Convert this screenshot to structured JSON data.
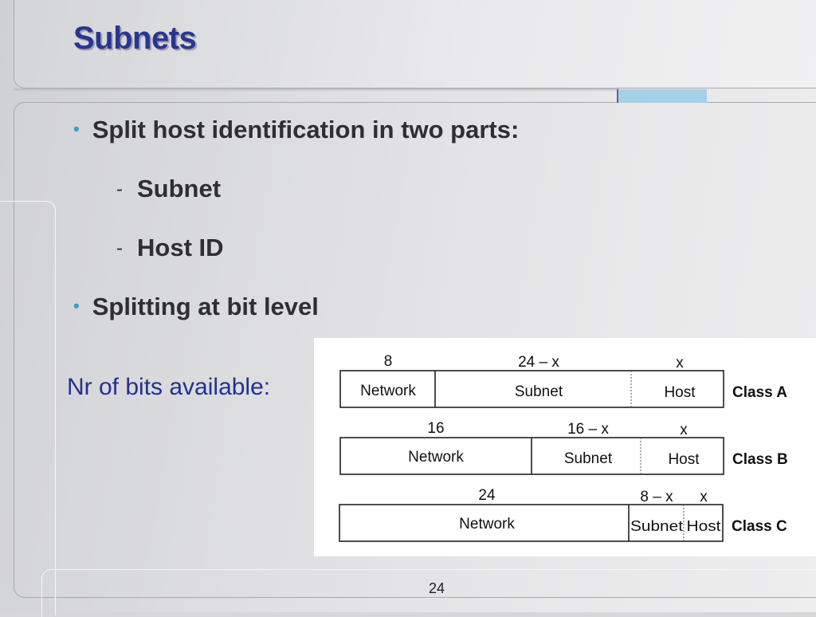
{
  "slide": {
    "title": "Subnets",
    "bullets": [
      {
        "text": "Split host identification in two parts:"
      },
      {
        "text": "Splitting at bit level"
      }
    ],
    "sub_bullets": [
      {
        "text": "Subnet"
      },
      {
        "text": "Host ID"
      }
    ],
    "note": "Nr of bits available:",
    "page_number": "24",
    "bullet_marker": "•",
    "dash_marker": "-"
  },
  "figure": {
    "rows": [
      {
        "class_label": "Class A",
        "widths": {
          "network": "8",
          "subnet": "24 – x",
          "host": "x"
        },
        "fields": {
          "network": "Network",
          "subnet": "Subnet",
          "host": "Host"
        }
      },
      {
        "class_label": "Class B",
        "widths": {
          "network": "16",
          "subnet": "16 – x",
          "host": "x"
        },
        "fields": {
          "network": "Network",
          "subnet": "Subnet",
          "host": "Host"
        }
      },
      {
        "class_label": "Class C",
        "widths": {
          "network": "24",
          "subnet": "8 – x",
          "host": "x"
        },
        "fields": {
          "network": "Network",
          "subnet": "Subnet",
          "host": "Host"
        }
      }
    ]
  },
  "colors": {
    "title": "#2a3592",
    "note": "#24308f",
    "bullet_dot": "#3aa0c8",
    "accent_bar": "#a7cfe7"
  }
}
